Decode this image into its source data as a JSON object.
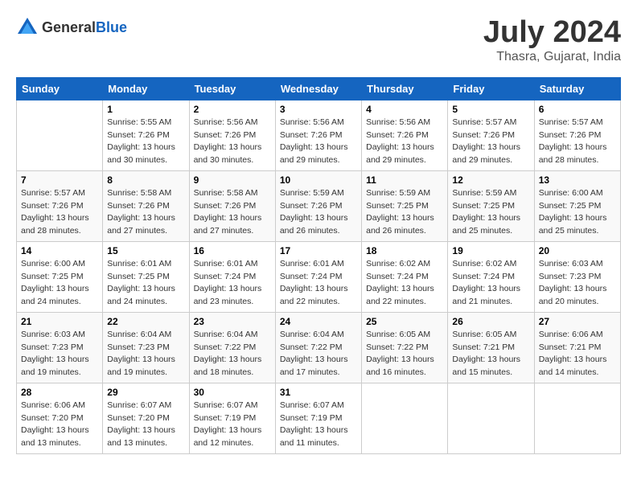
{
  "header": {
    "logo_general": "General",
    "logo_blue": "Blue",
    "title": "July 2024",
    "subtitle": "Thasra, Gujarat, India"
  },
  "calendar": {
    "days_of_week": [
      "Sunday",
      "Monday",
      "Tuesday",
      "Wednesday",
      "Thursday",
      "Friday",
      "Saturday"
    ],
    "weeks": [
      [
        {
          "day": "",
          "sunrise": "",
          "sunset": "",
          "daylight": ""
        },
        {
          "day": "1",
          "sunrise": "Sunrise: 5:55 AM",
          "sunset": "Sunset: 7:26 PM",
          "daylight": "Daylight: 13 hours and 30 minutes."
        },
        {
          "day": "2",
          "sunrise": "Sunrise: 5:56 AM",
          "sunset": "Sunset: 7:26 PM",
          "daylight": "Daylight: 13 hours and 30 minutes."
        },
        {
          "day": "3",
          "sunrise": "Sunrise: 5:56 AM",
          "sunset": "Sunset: 7:26 PM",
          "daylight": "Daylight: 13 hours and 29 minutes."
        },
        {
          "day": "4",
          "sunrise": "Sunrise: 5:56 AM",
          "sunset": "Sunset: 7:26 PM",
          "daylight": "Daylight: 13 hours and 29 minutes."
        },
        {
          "day": "5",
          "sunrise": "Sunrise: 5:57 AM",
          "sunset": "Sunset: 7:26 PM",
          "daylight": "Daylight: 13 hours and 29 minutes."
        },
        {
          "day": "6",
          "sunrise": "Sunrise: 5:57 AM",
          "sunset": "Sunset: 7:26 PM",
          "daylight": "Daylight: 13 hours and 28 minutes."
        }
      ],
      [
        {
          "day": "7",
          "sunrise": "Sunrise: 5:57 AM",
          "sunset": "Sunset: 7:26 PM",
          "daylight": "Daylight: 13 hours and 28 minutes."
        },
        {
          "day": "8",
          "sunrise": "Sunrise: 5:58 AM",
          "sunset": "Sunset: 7:26 PM",
          "daylight": "Daylight: 13 hours and 27 minutes."
        },
        {
          "day": "9",
          "sunrise": "Sunrise: 5:58 AM",
          "sunset": "Sunset: 7:26 PM",
          "daylight": "Daylight: 13 hours and 27 minutes."
        },
        {
          "day": "10",
          "sunrise": "Sunrise: 5:59 AM",
          "sunset": "Sunset: 7:26 PM",
          "daylight": "Daylight: 13 hours and 26 minutes."
        },
        {
          "day": "11",
          "sunrise": "Sunrise: 5:59 AM",
          "sunset": "Sunset: 7:25 PM",
          "daylight": "Daylight: 13 hours and 26 minutes."
        },
        {
          "day": "12",
          "sunrise": "Sunrise: 5:59 AM",
          "sunset": "Sunset: 7:25 PM",
          "daylight": "Daylight: 13 hours and 25 minutes."
        },
        {
          "day": "13",
          "sunrise": "Sunrise: 6:00 AM",
          "sunset": "Sunset: 7:25 PM",
          "daylight": "Daylight: 13 hours and 25 minutes."
        }
      ],
      [
        {
          "day": "14",
          "sunrise": "Sunrise: 6:00 AM",
          "sunset": "Sunset: 7:25 PM",
          "daylight": "Daylight: 13 hours and 24 minutes."
        },
        {
          "day": "15",
          "sunrise": "Sunrise: 6:01 AM",
          "sunset": "Sunset: 7:25 PM",
          "daylight": "Daylight: 13 hours and 24 minutes."
        },
        {
          "day": "16",
          "sunrise": "Sunrise: 6:01 AM",
          "sunset": "Sunset: 7:24 PM",
          "daylight": "Daylight: 13 hours and 23 minutes."
        },
        {
          "day": "17",
          "sunrise": "Sunrise: 6:01 AM",
          "sunset": "Sunset: 7:24 PM",
          "daylight": "Daylight: 13 hours and 22 minutes."
        },
        {
          "day": "18",
          "sunrise": "Sunrise: 6:02 AM",
          "sunset": "Sunset: 7:24 PM",
          "daylight": "Daylight: 13 hours and 22 minutes."
        },
        {
          "day": "19",
          "sunrise": "Sunrise: 6:02 AM",
          "sunset": "Sunset: 7:24 PM",
          "daylight": "Daylight: 13 hours and 21 minutes."
        },
        {
          "day": "20",
          "sunrise": "Sunrise: 6:03 AM",
          "sunset": "Sunset: 7:23 PM",
          "daylight": "Daylight: 13 hours and 20 minutes."
        }
      ],
      [
        {
          "day": "21",
          "sunrise": "Sunrise: 6:03 AM",
          "sunset": "Sunset: 7:23 PM",
          "daylight": "Daylight: 13 hours and 19 minutes."
        },
        {
          "day": "22",
          "sunrise": "Sunrise: 6:04 AM",
          "sunset": "Sunset: 7:23 PM",
          "daylight": "Daylight: 13 hours and 19 minutes."
        },
        {
          "day": "23",
          "sunrise": "Sunrise: 6:04 AM",
          "sunset": "Sunset: 7:22 PM",
          "daylight": "Daylight: 13 hours and 18 minutes."
        },
        {
          "day": "24",
          "sunrise": "Sunrise: 6:04 AM",
          "sunset": "Sunset: 7:22 PM",
          "daylight": "Daylight: 13 hours and 17 minutes."
        },
        {
          "day": "25",
          "sunrise": "Sunrise: 6:05 AM",
          "sunset": "Sunset: 7:22 PM",
          "daylight": "Daylight: 13 hours and 16 minutes."
        },
        {
          "day": "26",
          "sunrise": "Sunrise: 6:05 AM",
          "sunset": "Sunset: 7:21 PM",
          "daylight": "Daylight: 13 hours and 15 minutes."
        },
        {
          "day": "27",
          "sunrise": "Sunrise: 6:06 AM",
          "sunset": "Sunset: 7:21 PM",
          "daylight": "Daylight: 13 hours and 14 minutes."
        }
      ],
      [
        {
          "day": "28",
          "sunrise": "Sunrise: 6:06 AM",
          "sunset": "Sunset: 7:20 PM",
          "daylight": "Daylight: 13 hours and 13 minutes."
        },
        {
          "day": "29",
          "sunrise": "Sunrise: 6:07 AM",
          "sunset": "Sunset: 7:20 PM",
          "daylight": "Daylight: 13 hours and 13 minutes."
        },
        {
          "day": "30",
          "sunrise": "Sunrise: 6:07 AM",
          "sunset": "Sunset: 7:19 PM",
          "daylight": "Daylight: 13 hours and 12 minutes."
        },
        {
          "day": "31",
          "sunrise": "Sunrise: 6:07 AM",
          "sunset": "Sunset: 7:19 PM",
          "daylight": "Daylight: 13 hours and 11 minutes."
        },
        {
          "day": "",
          "sunrise": "",
          "sunset": "",
          "daylight": ""
        },
        {
          "day": "",
          "sunrise": "",
          "sunset": "",
          "daylight": ""
        },
        {
          "day": "",
          "sunrise": "",
          "sunset": "",
          "daylight": ""
        }
      ]
    ]
  }
}
